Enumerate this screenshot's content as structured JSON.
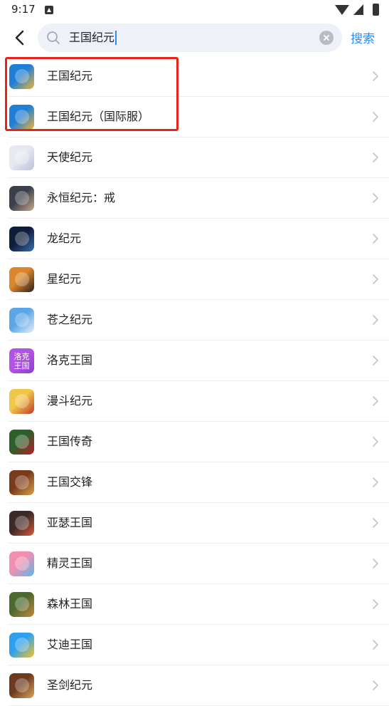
{
  "status_bar": {
    "time": "9:17",
    "icons": [
      "notification-icon",
      "wifi-icon",
      "signal-icon",
      "battery-icon"
    ]
  },
  "search": {
    "query": "王国纪元",
    "button_label": "搜索",
    "accent_color": "#2b8cf0"
  },
  "results": [
    {
      "name": "王国纪元",
      "icon": "kingdom-era-app-icon",
      "colors": [
        "#1f7fd6",
        "#f0b23a"
      ]
    },
    {
      "name": "王国纪元（国际服）",
      "icon": "kingdom-era-intl-app-icon",
      "colors": [
        "#1f7fd6",
        "#f0b23a"
      ]
    },
    {
      "name": "天使纪元",
      "icon": "angel-era-app-icon",
      "colors": [
        "#e7e9f0",
        "#b9c3d8"
      ]
    },
    {
      "name": "永恒纪元：戒",
      "icon": "eternal-era-app-icon",
      "colors": [
        "#3a3f4a",
        "#c9a88d"
      ]
    },
    {
      "name": "龙纪元",
      "icon": "dragon-era-app-icon",
      "colors": [
        "#0f1c3a",
        "#3d6ea8"
      ]
    },
    {
      "name": "星纪元",
      "icon": "star-era-app-icon",
      "colors": [
        "#d9862c",
        "#2a1d1a"
      ]
    },
    {
      "name": "苍之纪元",
      "icon": "cang-era-app-icon",
      "colors": [
        "#5aa6e6",
        "#e9eef6"
      ]
    },
    {
      "name": "洛克王国",
      "icon": "roco-kingdom-app-icon",
      "colors": [
        "#b552e6",
        "#8b3fd1"
      ],
      "icon_text": "洛克王国"
    },
    {
      "name": "漫斗纪元",
      "icon": "mandou-era-app-icon",
      "colors": [
        "#f1c74a",
        "#c0392b"
      ]
    },
    {
      "name": "王国传奇",
      "icon": "kingdom-legend-app-icon",
      "colors": [
        "#2c5f2a",
        "#b81f2a"
      ]
    },
    {
      "name": "王国交锋",
      "icon": "kingdom-clash-app-icon",
      "colors": [
        "#7a3a1c",
        "#d8a24a"
      ]
    },
    {
      "name": "亚瑟王国",
      "icon": "arthur-kingdom-app-icon",
      "colors": [
        "#3b2a26",
        "#d65b3a"
      ]
    },
    {
      "name": "精灵王国",
      "icon": "elf-kingdom-app-icon",
      "colors": [
        "#f08fb0",
        "#5ab7e8"
      ]
    },
    {
      "name": "森林王国",
      "icon": "forest-kingdom-app-icon",
      "colors": [
        "#4b6a2e",
        "#c7853d"
      ]
    },
    {
      "name": "艾迪王国",
      "icon": "eddie-kingdom-app-icon",
      "colors": [
        "#2fa0f0",
        "#f5c623"
      ]
    },
    {
      "name": "圣剑纪元",
      "icon": "holy-sword-era-app-icon",
      "colors": [
        "#6b3a1f",
        "#d9a45c"
      ]
    }
  ],
  "highlight_color": "#e8231c"
}
